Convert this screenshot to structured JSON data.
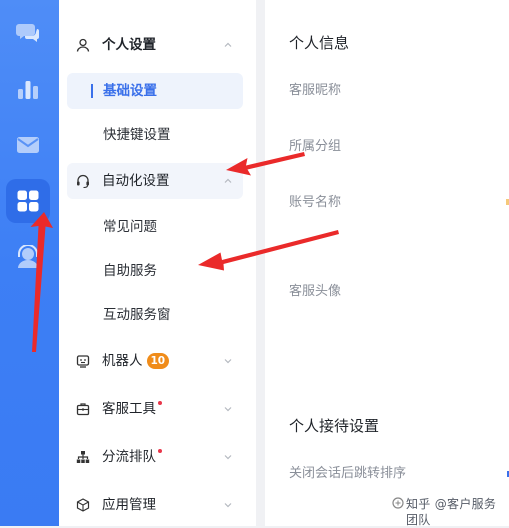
{
  "colors": {
    "rail": "#3d7ff5",
    "accent": "#3a70ea",
    "badge": "#f08c1a",
    "dot": "#e8364a",
    "arrow": "#ea2a2a"
  },
  "rail": {
    "items": [
      {
        "icon": "chat-bubbles-icon",
        "active": false
      },
      {
        "icon": "bar-chart-icon",
        "active": false
      },
      {
        "icon": "mail-icon",
        "active": false
      },
      {
        "icon": "apps-grid-icon",
        "active": true
      },
      {
        "icon": "agent-headset-icon",
        "active": false
      }
    ]
  },
  "sidebar": {
    "personal_settings": "个人设置",
    "basic_settings": "基础设置",
    "shortcut_settings": "快捷键设置",
    "automation_settings": "自动化设置",
    "faq": "常见问题",
    "self_service": "自助服务",
    "interactive_window": "互动服务窗",
    "robot": "机器人",
    "robot_badge": "10",
    "service_tools": "客服工具",
    "routing_queue": "分流排队",
    "app_management": "应用管理"
  },
  "content": {
    "personal_info_title": "个人信息",
    "nickname_label": "客服昵称",
    "group_label": "所属分组",
    "account_label": "账号名称",
    "avatar_label": "客服头像",
    "reception_title": "个人接待设置",
    "close_session_label": "关闭会话后跳转排序"
  },
  "watermark": {
    "text": "知乎 @客户服务团队"
  }
}
